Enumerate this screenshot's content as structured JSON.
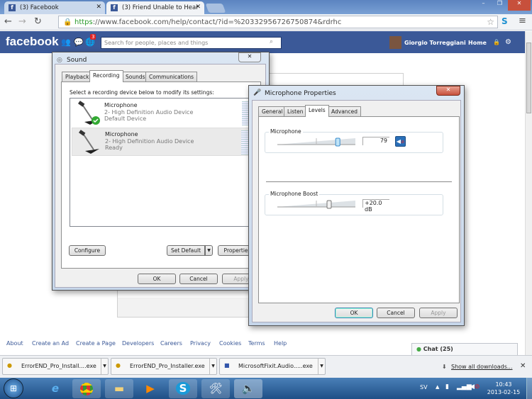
{
  "browser": {
    "tabs": [
      {
        "label": "(3) Facebook"
      },
      {
        "label": "(3) Friend Unable to Hear"
      }
    ],
    "url_scheme": "https",
    "url_rest": "://www.facebook.com/help/contact/?id=%20332956726750874&rdrhc"
  },
  "facebook": {
    "logo": "facebook",
    "notification_count": "3",
    "search_placeholder": "Search for people, places and things",
    "user_name": "Giorgio Torreggiani",
    "home": "Home",
    "footer_links": [
      "About",
      "Create an Ad",
      "Create a Page",
      "Developers",
      "Careers",
      "Privacy",
      "Cookies",
      "Terms",
      "Help"
    ],
    "chat": "Chat (25)"
  },
  "sound_dialog": {
    "title": "Sound",
    "tabs": [
      "Playback",
      "Recording",
      "Sounds",
      "Communications"
    ],
    "active_tab": "Recording",
    "instruction": "Select a recording device below to modify its settings:",
    "devices": [
      {
        "name": "Microphone",
        "driver": "2- High Definition Audio Device",
        "status": "Default Device"
      },
      {
        "name": "Microphone",
        "driver": "2- High Definition Audio Device",
        "status": "Ready"
      }
    ],
    "configure": "Configure",
    "set_default": "Set Default",
    "properties": "Properties",
    "ok": "OK",
    "cancel": "Cancel",
    "apply": "Apply"
  },
  "mic_dialog": {
    "title": "Microphone Properties",
    "tabs": [
      "General",
      "Listen",
      "Levels",
      "Advanced"
    ],
    "active_tab": "Levels",
    "microphone_label": "Microphone",
    "microphone_value": "79",
    "boost_label": "Microphone Boost",
    "boost_value": "+20.0 dB",
    "ok": "OK",
    "cancel": "Cancel",
    "apply": "Apply"
  },
  "downloads": {
    "items": [
      "ErrorEND_Pro_Install....exe",
      "ErrorEND_Pro_Installer.exe",
      "MicrosoftFixit.Audio.....exe"
    ],
    "show_all": "Show all downloads..."
  },
  "taskbar": {
    "language": "SV",
    "time": "10:43",
    "date": "2013-02-15"
  }
}
